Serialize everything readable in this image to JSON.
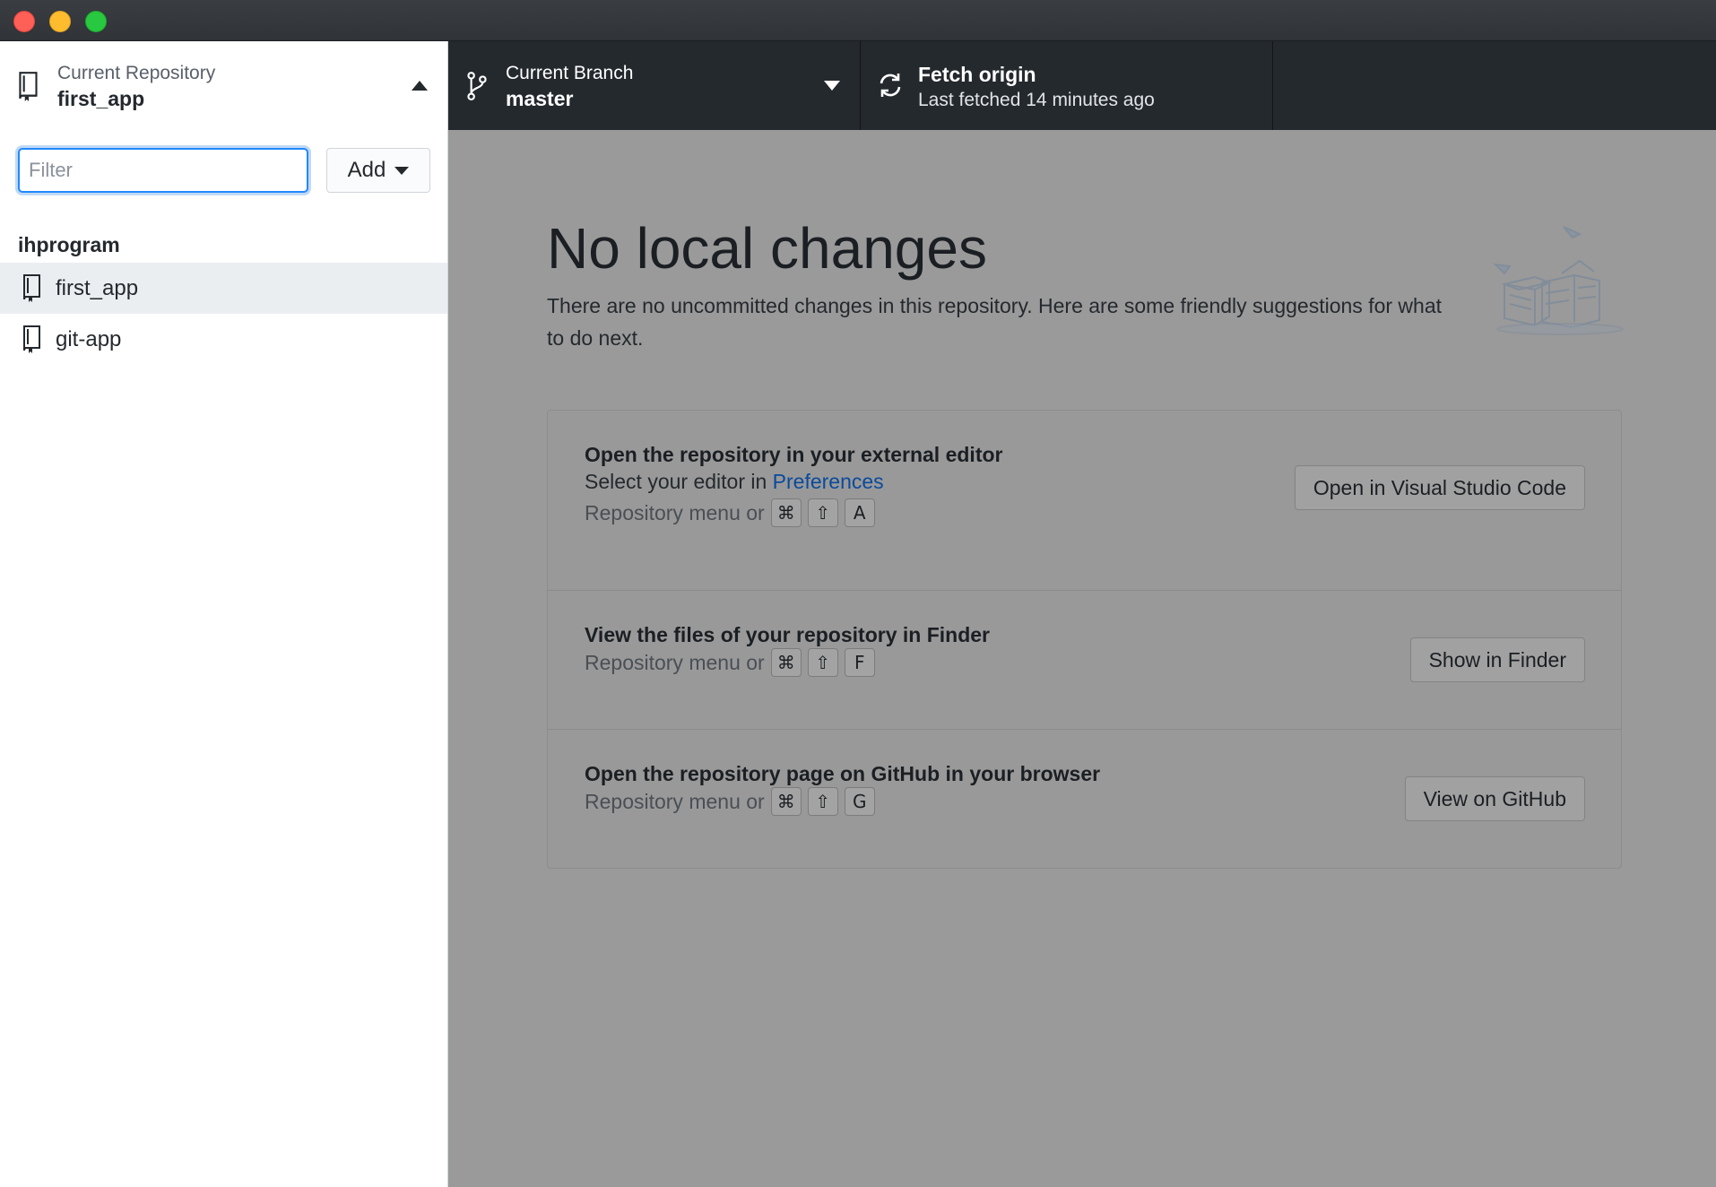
{
  "toolbar": {
    "repository": {
      "label": "Current Repository",
      "value": "first_app"
    },
    "branch": {
      "label": "Current Branch",
      "value": "master"
    },
    "fetch": {
      "label": "Fetch origin",
      "value": "Last fetched 14 minutes ago"
    }
  },
  "sidebar": {
    "filter_placeholder": "Filter",
    "add_label": "Add",
    "group": "ihprogram",
    "repos": [
      {
        "label": "first_app",
        "selected": true
      },
      {
        "label": "git-app",
        "selected": false
      }
    ]
  },
  "main": {
    "title": "No local changes",
    "description": "There are no uncommitted changes in this repository. Here are some friendly suggestions for what to do next.",
    "suggestions": [
      {
        "title": "Open the repository in your external editor",
        "subtitle_prefix": "Select your editor in ",
        "subtitle_link": "Preferences",
        "shortcut_prefix": "Repository menu or",
        "keys": [
          "⌘",
          "⇧",
          "A"
        ],
        "button": "Open in Visual Studio Code"
      },
      {
        "title": "View the files of your repository in Finder",
        "shortcut_prefix": "Repository menu or",
        "keys": [
          "⌘",
          "⇧",
          "F"
        ],
        "button": "Show in Finder"
      },
      {
        "title": "Open the repository page on GitHub in your browser",
        "shortcut_prefix": "Repository menu or",
        "keys": [
          "⌘",
          "⇧",
          "G"
        ],
        "button": "View on GitHub"
      }
    ]
  },
  "colors": {
    "toolbar_bg": "#24292e",
    "main_bg": "#9a9a9a",
    "accent": "#2188ff",
    "link": "#0b4a9c",
    "close": "#fe5f57",
    "minimize": "#febc2e",
    "maximize": "#28c840"
  },
  "icons": [
    "repo-icon",
    "branch-icon",
    "sync-icon",
    "caret-up-icon",
    "caret-down-icon"
  ]
}
